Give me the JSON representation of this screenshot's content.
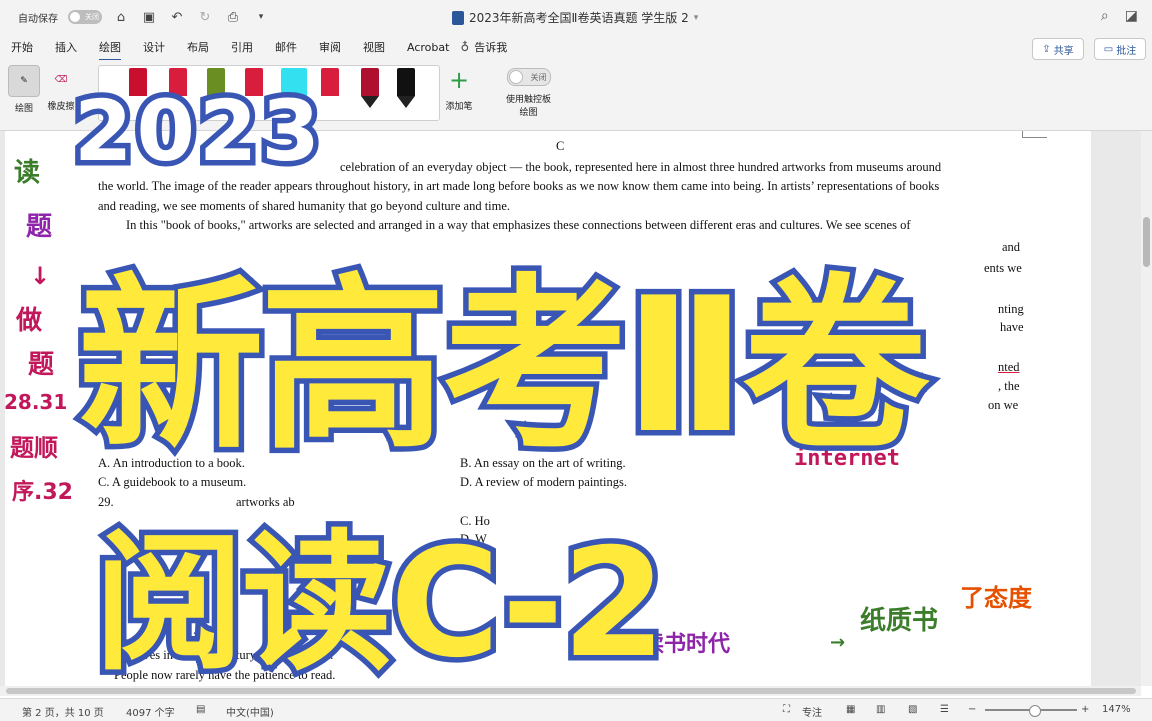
{
  "titlebar": {
    "autosave_label": "自动保存",
    "toggle_label": "关闭",
    "doc_title": "2023年新高考全国Ⅱ卷英语真题 学生版 2"
  },
  "tabs": [
    "开始",
    "插入",
    "绘图",
    "设计",
    "布局",
    "引用",
    "邮件",
    "审阅",
    "视图",
    "Acrobat",
    "告诉我"
  ],
  "active_tab": "绘图",
  "share_label": "共享",
  "comment_label": "批注",
  "toolbar": {
    "draw_label": "绘图",
    "eraser_label": "橡皮擦",
    "add_pen_label": "添加笔",
    "touch_toggle_label": "关闭",
    "touch_label_1": "使用触控板",
    "touch_label_2": "绘图",
    "pen_colors": [
      "#c8102e",
      "#d81e3c",
      "#6b8e23",
      "#d81e3c",
      "#33e0f0",
      "#d81e3c",
      "#b01030",
      "#111111"
    ]
  },
  "document": {
    "section_letter": "C",
    "lines": [
      "celebration of an everyday object  —  the book, represented here in almost three hundred artworks from museums around",
      "the world. The image of the reader appears throughout history, in art made long before books as we now know them came into being. In artists’ representations of books",
      "and reading, we see moments of shared humanity that go beyond culture and time.",
      "In this \"book of books,\" artworks are selected and arranged in a way that emphasizes these connections between different eras and cultures. We see scenes of"
    ],
    "options": {
      "q28_a": "A. An introduction to a book.",
      "q28_b": "B. An essay on the art of writing.",
      "q28_c": "C. A guidebook to a museum.",
      "q28_d": "D. A review of modern paintings.",
      "q29_stem": "29.",
      "q29_c": "C. Ho",
      "q29_d": "D. W"
    },
    "bottom_lines": [
      "Our lives in the 21st century are networked.",
      "People now rarely have the patience to read."
    ],
    "fragments": [
      "nting",
      "have",
      "nted",
      ", the",
      "on we",
      "ents we",
      "and",
      "artworks ab",
      "Our"
    ]
  },
  "statusbar": {
    "page": "第 2 页，共 10 页",
    "words": "4097 个字",
    "language": "中文(中国)",
    "focus": "专注",
    "zoom": "147%"
  },
  "overlay": {
    "year": "2023",
    "main": "新高考Ⅱ卷",
    "sub": "阅读C-2"
  },
  "annotations": {
    "left_vertical": [
      "读",
      "题",
      "↓",
      "做",
      "题",
      "28.31",
      "题顺",
      "序.32"
    ],
    "internet": "internet",
    "bottom_right": "纸质书",
    "bottom_right_2": "了态度",
    "bottom_mid": "旧时的读书时代"
  }
}
